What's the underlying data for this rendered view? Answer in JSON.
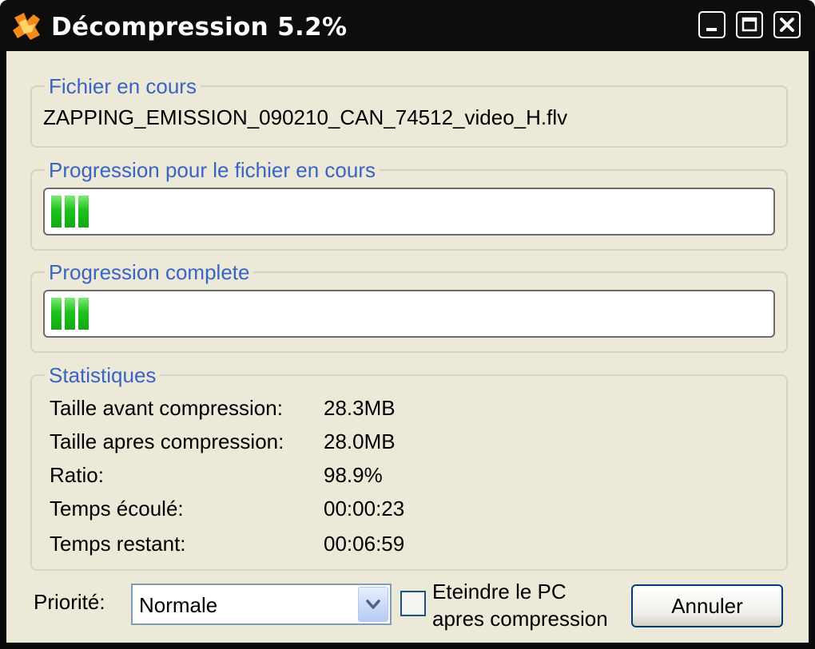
{
  "window": {
    "title": "Décompression 5.2%",
    "minimize_icon": "minimize-icon",
    "maximize_icon": "maximize-icon",
    "close_icon": "close-icon"
  },
  "current_file": {
    "legend": "Fichier en cours",
    "name": "ZAPPING_EMISSION_090210_CAN_74512_video_H.flv"
  },
  "file_progress": {
    "legend": "Progression pour le fichier en cours",
    "percent": 5.2
  },
  "total_progress": {
    "legend": "Progression complete",
    "percent": 5.2
  },
  "statistics": {
    "legend": "Statistiques",
    "rows": [
      {
        "label": "Taille avant compression:",
        "value": "28.3MB"
      },
      {
        "label": "Taille apres compression:",
        "value": "28.0MB"
      },
      {
        "label": "Ratio:",
        "value": "98.9%"
      },
      {
        "label": "Temps écoulé:",
        "value": "00:00:23"
      },
      {
        "label": "Temps restant:",
        "value": "00:06:59"
      }
    ]
  },
  "footer": {
    "priority_label": "Priorité:",
    "priority_value": "Normale",
    "shutdown_line1": "Eteindre le PC",
    "shutdown_line2": "apres compression",
    "shutdown_checked": false,
    "cancel_label": "Annuler"
  },
  "colors": {
    "legend": "#3a64c4",
    "progress_fill": "#1fc21b",
    "window_frame": "#0d0d0d",
    "dialog_bg": "#ece9d8"
  }
}
